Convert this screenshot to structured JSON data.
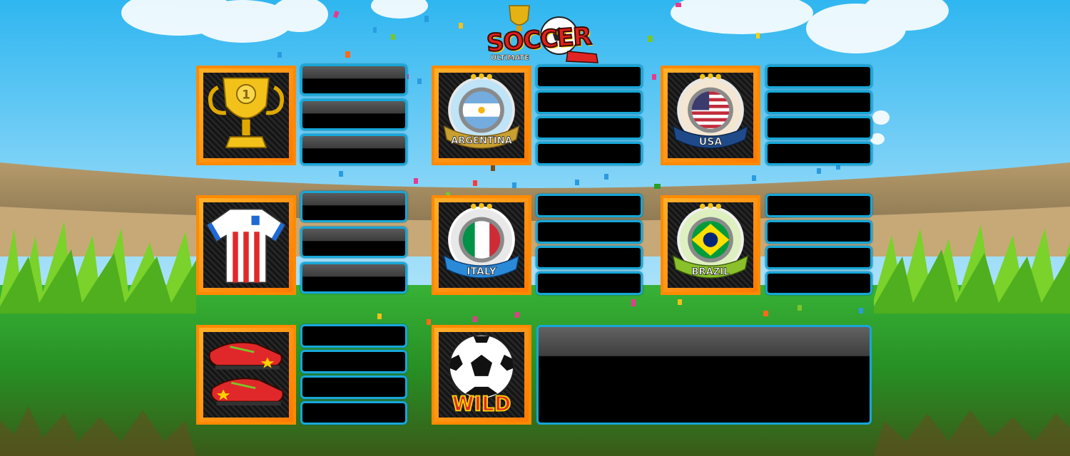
{
  "game": {
    "logo_title": "SOCCER",
    "logo_subtitle": "ULTIMATE"
  },
  "symbols": [
    {
      "id": "trophy",
      "icon": "trophy-icon",
      "name": ""
    },
    {
      "id": "argentina",
      "icon": "argentina-flag-badge-icon",
      "name": "ARGENTINA"
    },
    {
      "id": "usa",
      "icon": "usa-flag-badge-icon",
      "name": "USA"
    },
    {
      "id": "jersey",
      "icon": "jersey-icon",
      "name": ""
    },
    {
      "id": "italy",
      "icon": "italy-flag-badge-icon",
      "name": "ITALY"
    },
    {
      "id": "brazil",
      "icon": "brazil-flag-badge-icon",
      "name": "BRAZIL"
    },
    {
      "id": "boots",
      "icon": "soccer-boots-icon",
      "name": ""
    },
    {
      "id": "wild",
      "icon": "soccer-ball-icon",
      "name": "WILD"
    }
  ],
  "colors": {
    "tile_border": "#ff8a00",
    "paytable_border": "#17a7d8",
    "sky": "#4fc3f7",
    "grass": "#2e9e2a"
  }
}
